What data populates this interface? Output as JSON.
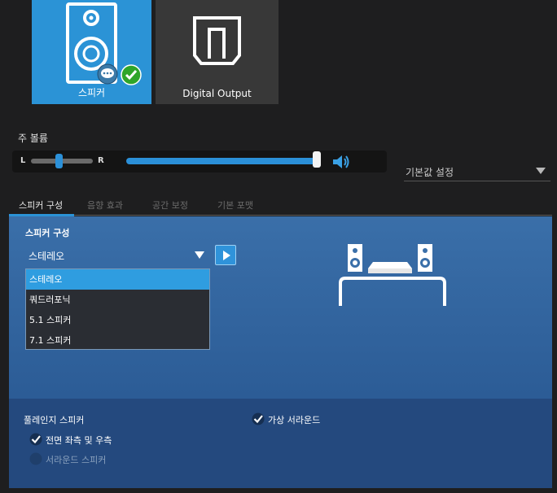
{
  "devices": [
    {
      "label": "스피커",
      "selected": true
    },
    {
      "label": "Digital Output",
      "selected": false
    }
  ],
  "volume": {
    "title": "주 볼륨",
    "balance_left_label": "L",
    "balance_right_label": "R",
    "balance_position": 0.5,
    "level": 1.0
  },
  "defaults_dropdown": {
    "label": "기본값 설정"
  },
  "tabs": [
    {
      "label": "스피커 구성",
      "active": true
    },
    {
      "label": "음향 효과",
      "active": false
    },
    {
      "label": "공간 보정",
      "active": false
    },
    {
      "label": "기본 포맷",
      "active": false
    }
  ],
  "speaker_config": {
    "title": "스피커 구성",
    "selected": "스테레오",
    "options": [
      "스테레오",
      "쿼드러포닉",
      "5.1 스피커",
      "7.1 스피커"
    ]
  },
  "fullrange": {
    "title": "풀레인지 스피커",
    "front_lr": {
      "label": "전면 좌측 및 우측",
      "checked": true
    },
    "surround": {
      "label": "서라운드 스피커",
      "checked": false,
      "enabled": false
    }
  },
  "virtual_surround": {
    "label": "가상 서라운드",
    "checked": true
  },
  "colors": {
    "accent": "#2b93d6",
    "panel": "#3a6fa9",
    "background": "#1e1e1f"
  }
}
